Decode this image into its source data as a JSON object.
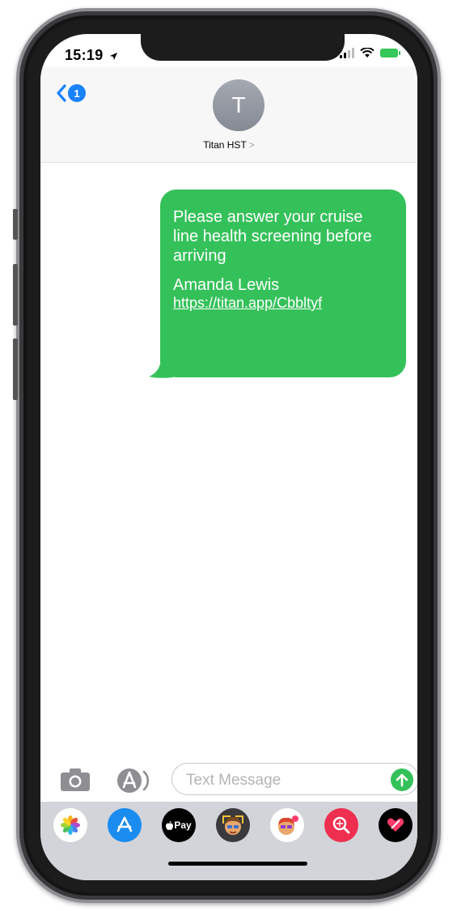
{
  "status_bar": {
    "time": "15:19"
  },
  "header": {
    "back_count": "1",
    "avatar_initial": "T",
    "contact_name": "Titan HST",
    "contact_chevron": ">"
  },
  "messages": [
    {
      "direction": "outgoing",
      "text": "Please answer your cruise line health screening before arriving",
      "sender": "Amanda Lewis",
      "link": "https://titan.app/Cbbltyf"
    }
  ],
  "composer": {
    "placeholder": "Text Message"
  },
  "app_tray": {
    "items": [
      {
        "icon": "photos-icon"
      },
      {
        "icon": "app-store-icon"
      },
      {
        "label": "Pay",
        "icon": "apple-pay-icon"
      },
      {
        "icon": "memoji-icon"
      },
      {
        "icon": "animoji-icon"
      },
      {
        "icon": "image-search-icon"
      },
      {
        "icon": "digital-touch-icon"
      }
    ]
  },
  "colors": {
    "bubble": "#35c15a",
    "accent": "#1a82fb",
    "tray": "#d2d4d9"
  }
}
